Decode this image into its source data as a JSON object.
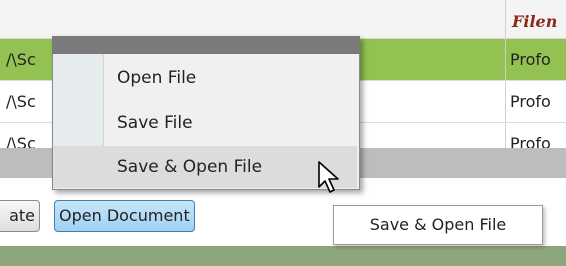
{
  "grid": {
    "header": {
      "column_type": "Filen"
    },
    "rows": [
      {
        "path": "/\\Sc",
        "type": "Profo",
        "selected": true
      },
      {
        "path": "/\\Sc",
        "type": "Profo",
        "selected": false
      },
      {
        "path": "/\\Sc",
        "type": "Profo",
        "selected": false
      }
    ]
  },
  "toolbar": {
    "partial_button_label": "ate",
    "open_document_label": "Open Document"
  },
  "tooltip": {
    "text": "Save & Open File"
  },
  "context_menu": {
    "items": [
      {
        "label": "Open File"
      },
      {
        "label": "Save File"
      },
      {
        "label": "Save & Open File",
        "hovered": true
      }
    ]
  },
  "colors": {
    "selected_row": "#93c253",
    "header_text": "#8b2a1a",
    "active_button": "#9fd0f3",
    "bottom_strip": "#8ea67b"
  },
  "icons": {
    "cursor": "mouse-pointer-icon"
  }
}
